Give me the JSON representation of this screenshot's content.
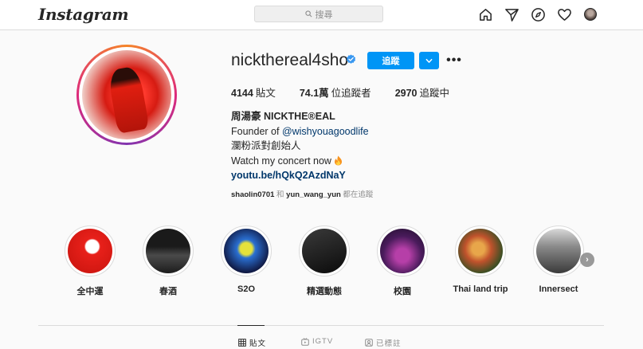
{
  "nav": {
    "logo": "Instagram",
    "search_placeholder": "搜尋"
  },
  "profile": {
    "username": "nickthereal4sho",
    "verified": true,
    "follow_label": "追蹤",
    "stats": {
      "posts_count": "4144",
      "posts_label": "貼文",
      "followers_count": "74.1萬",
      "followers_label": "位追蹤者",
      "following_count": "2970",
      "following_label": "追蹤中"
    },
    "bio": {
      "full_name": "周湯豪 NICKTHE®EAL",
      "founder_prefix": "Founder of ",
      "founder_handle": "@wishyouagoodlife",
      "line3": "瀾粉派對創始人",
      "line4": "Watch my concert now",
      "link": "youtu.be/hQkQ2AzdNaY"
    },
    "followed_by": {
      "user1": "shaolin0701",
      "and": " 和 ",
      "user2": "yun_wang_yun",
      "suffix": " 都在追蹤"
    }
  },
  "highlights": [
    {
      "label": "全中運"
    },
    {
      "label": "春酒"
    },
    {
      "label": "S2O"
    },
    {
      "label": "精選動態"
    },
    {
      "label": "校園"
    },
    {
      "label": "Thai land trip"
    },
    {
      "label": "Innersect"
    }
  ],
  "tabs": [
    {
      "label": "貼文",
      "icon": "grid-icon",
      "active": true
    },
    {
      "label": "IGTV",
      "icon": "igtv-icon",
      "active": false
    },
    {
      "label": "已標註",
      "icon": "tagged-icon",
      "active": false
    }
  ],
  "colors": {
    "primary_button": "#0095f6",
    "link": "#00376b",
    "verified": "#3897f0"
  }
}
